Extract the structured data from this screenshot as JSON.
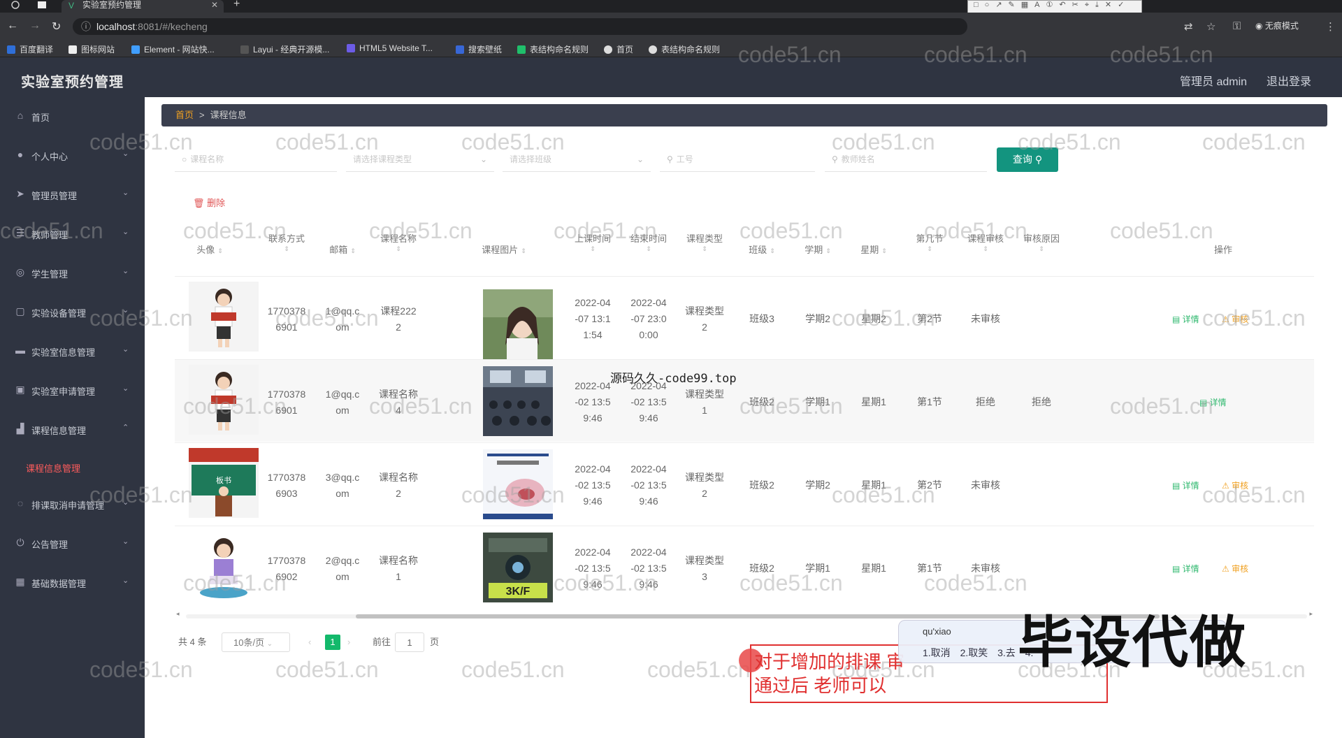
{
  "browser": {
    "tab_title": "实验室预约管理",
    "url": "localhost:8081/#/kecheng",
    "url_host": "localhost",
    "url_rest": ":8081/#/kecheng",
    "incognito": "无痕模式",
    "bookmarks": [
      "百度翻译",
      "图标网站",
      "Element - 网站快...",
      "Layui - 经典开源模...",
      "HTML5 Website T...",
      "搜索壁纸",
      "表结构命名规则",
      "首页",
      "表结构命名规则"
    ],
    "draw_size": "20"
  },
  "app": {
    "title": "实验室预约管理",
    "user_label": "管理员 admin",
    "logout": "退出登录"
  },
  "sidebar": {
    "items": [
      {
        "label": "首页",
        "icon": "home-icon"
      },
      {
        "label": "个人中心",
        "icon": "user-icon"
      },
      {
        "label": "管理员管理",
        "icon": "send-icon"
      },
      {
        "label": "教师管理",
        "icon": "list-icon"
      },
      {
        "label": "学生管理",
        "icon": "compass-icon"
      },
      {
        "label": "实验设备管理",
        "icon": "box-icon"
      },
      {
        "label": "实验室信息管理",
        "icon": "monitor-icon"
      },
      {
        "label": "实验室申请管理",
        "icon": "chat-icon"
      },
      {
        "label": "课程信息管理",
        "icon": "chart-icon"
      },
      {
        "label": "排课取消申请管理",
        "icon": "circle-icon"
      },
      {
        "label": "公告管理",
        "icon": "power-icon"
      },
      {
        "label": "基础数据管理",
        "icon": "grid-icon"
      }
    ],
    "sub_active": "课程信息管理"
  },
  "breadcrumb": {
    "home": "首页",
    "sep": ">",
    "current": "课程信息"
  },
  "filters": {
    "course_name": "课程名称",
    "course_type": "请选择课程类型",
    "class": "请选择班级",
    "work_no": "工号",
    "teacher_name": "教师姓名",
    "search_label": "查询",
    "delete_label": "删除"
  },
  "table": {
    "headers": [
      "头像",
      "联系方式",
      "邮箱",
      "课程名称",
      "课程图片",
      "上课时间",
      "结束时间",
      "课程类型",
      "班级",
      "学期",
      "星期",
      "第几节",
      "课程审核",
      "审核原因",
      "操作"
    ],
    "rows": [
      {
        "phone": [
          "1770378",
          "6901"
        ],
        "email": [
          "1@qq.c",
          "om"
        ],
        "course": [
          "课程222",
          "2"
        ],
        "start": [
          "2022-04",
          "-07 13:1",
          "1:54"
        ],
        "end": [
          "2022-04",
          "-07 23:0",
          "0:00"
        ],
        "type": [
          "课程类型",
          "2"
        ],
        "cls": "班级3",
        "term": "学期2",
        "week": "星期2",
        "section": "第2节",
        "review": "未审核",
        "reason": "",
        "actions": [
          "详情",
          "审核"
        ]
      },
      {
        "phone": [
          "1770378",
          "6901"
        ],
        "email": [
          "1@qq.c",
          "om"
        ],
        "course": [
          "课程名称",
          "4"
        ],
        "start": [
          "2022-04",
          "-02 13:5",
          "9:46"
        ],
        "end": [
          "2022-04",
          "-02 13:5",
          "9:46"
        ],
        "type": [
          "课程类型",
          "1"
        ],
        "cls": "班级2",
        "term": "学期1",
        "week": "星期1",
        "section": "第1节",
        "review": "拒绝",
        "reason": "拒绝",
        "actions": [
          "详情"
        ]
      },
      {
        "phone": [
          "1770378",
          "6903"
        ],
        "email": [
          "3@qq.c",
          "om"
        ],
        "course": [
          "课程名称",
          "2"
        ],
        "start": [
          "2022-04",
          "-02 13:5",
          "9:46"
        ],
        "end": [
          "2022-04",
          "-02 13:5",
          "9:46"
        ],
        "type": [
          "课程类型",
          "2"
        ],
        "cls": "班级2",
        "term": "学期2",
        "week": "星期1",
        "section": "第2节",
        "review": "未审核",
        "reason": "",
        "actions": [
          "详情",
          "审核"
        ]
      },
      {
        "phone": [
          "1770378",
          "6902"
        ],
        "email": [
          "2@qq.c",
          "om"
        ],
        "course": [
          "课程名称",
          "1"
        ],
        "start": [
          "2022-04",
          "-02 13:5",
          "9:46"
        ],
        "end": [
          "2022-04",
          "-02 13:5",
          "9:46"
        ],
        "type": [
          "课程类型",
          "3"
        ],
        "cls": "班级2",
        "term": "学期1",
        "week": "星期1",
        "section": "第1节",
        "review": "未审核",
        "reason": "",
        "actions": [
          "详情",
          "审核"
        ]
      }
    ]
  },
  "pagination": {
    "total": "共 4 条",
    "page_size": "10条/页",
    "current": "1",
    "goto": "前往",
    "goto_value": "1",
    "page_unit": "页"
  },
  "overlays": {
    "watermark": "code51.cn",
    "code_banner": "源码久久-code99.top",
    "big_text": "毕设代做",
    "ime_pinyin": "qu'xiao",
    "ime_candidates": "1.取消 2.取笑 3.去 4.",
    "annotation": [
      "对于增加的排课 审",
      "通过后 老师可以"
    ]
  },
  "colors": {
    "sidebar_bg": "#2f3441",
    "accent": "#13947f",
    "active_red": "#ff5c5c",
    "breadcrumb_home": "#f0a020"
  }
}
